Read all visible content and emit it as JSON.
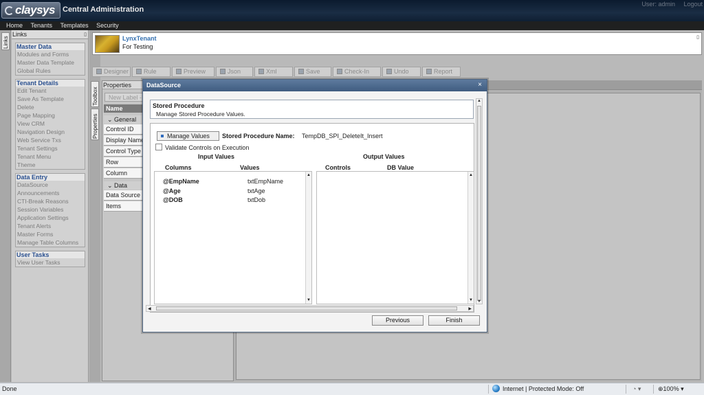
{
  "header": {
    "logo_text": "claysys",
    "app_title": "Central Administration",
    "user_label": "User: admin",
    "logout_label": "Logout"
  },
  "menu": [
    "Home",
    "Tenants",
    "Templates",
    "Security"
  ],
  "left_tab": "Links",
  "links_panel": {
    "title": "Links",
    "groups": [
      {
        "title": "Master Data",
        "items": [
          "Modules and Forms",
          "Master Data Template",
          "Global Rules"
        ]
      },
      {
        "title": "Tenant Details",
        "items": [
          "Edit Tenant",
          "Save As Template",
          "Delete",
          "Page Mapping",
          "View CRM",
          "Navigation Design",
          "Web Service Txs",
          "Tenant Settings",
          "Tenant Menu",
          "Theme"
        ]
      },
      {
        "title": "Data Entry",
        "items": [
          "DataSource",
          "Announcements",
          "CTI-Break Reasons",
          "Session Variables",
          "Application Settings",
          "Tenant Alerts",
          "Master Forms",
          "Manage Table Columns"
        ]
      },
      {
        "title": "User Tasks",
        "items": [
          "View User Tasks"
        ]
      }
    ]
  },
  "side_tabs": {
    "toolbox": "Toolbox",
    "properties": "Properties"
  },
  "tenant": {
    "name": "LynxTenant",
    "description": "For Testing"
  },
  "toolbar": [
    "Designer",
    "Rule",
    "Preview",
    "Json",
    "Xml",
    "Save",
    "Check-In",
    "Undo",
    "Report"
  ],
  "properties": {
    "title": "Properties",
    "new_label": "New Label -",
    "column_header": "Name",
    "section_general": "General",
    "general_rows": [
      "Control ID",
      "Display Name",
      "Control Type",
      "Row",
      "Column"
    ],
    "section_datasource": "Data Source",
    "datasource_rows": [
      "Data Source",
      "Items"
    ]
  },
  "modal": {
    "title": "DataSource",
    "close": "×",
    "sp_title": "Stored Procedure",
    "sp_desc": "Manage Stored Procedure Values.",
    "manage_values_label": "Manage Values",
    "sp_name_label": "Stored Procedure Name:",
    "sp_name_value": "TempDB_SPI_DeleteIt_Insert",
    "validate_label": "Validate Controls on Execution",
    "validate_checked": false,
    "input_values_title": "Input Values",
    "input_col_columns": "Columns",
    "input_col_values": "Values",
    "output_values_title": "Output Values",
    "output_col_controls": "Controls",
    "output_col_dbvalue": "DB Value",
    "input_rows": [
      {
        "column": "@EmpName",
        "value": "txtEmpName"
      },
      {
        "column": "@Age",
        "value": "txtAge"
      },
      {
        "column": "@DOB",
        "value": "txtDob"
      }
    ],
    "previous_label": "Previous",
    "finish_label": "Finish"
  },
  "status": {
    "left": "Done",
    "zone": "Internet | Protected Mode: Off",
    "zoom": "100%"
  },
  "colors": {
    "header_bg": "#0b1a2e",
    "modal_title_bg": "#4a6890",
    "link_group_title": "#2a5090"
  }
}
